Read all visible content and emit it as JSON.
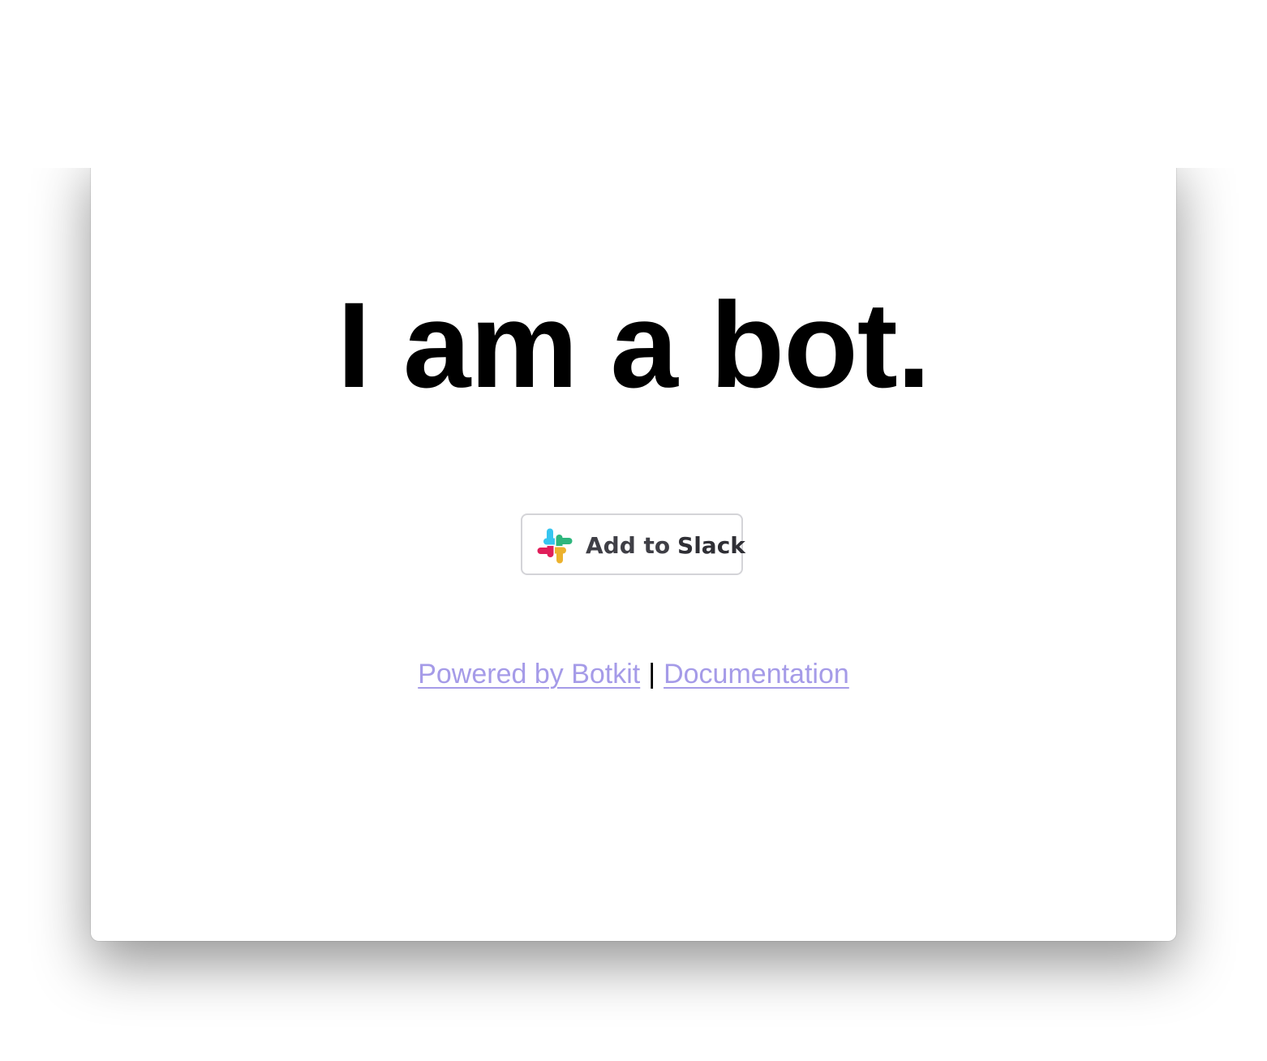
{
  "page": {
    "title": "I am a bot.",
    "add_to_slack": {
      "prefix": "Add to",
      "brand": "Slack",
      "icon": "slack-logo-icon"
    },
    "links": {
      "powered_by": "Powered by Botkit",
      "separator": "|",
      "documentation": "Documentation"
    }
  },
  "colors": {
    "background": "#ffffff",
    "headline": "#000000",
    "link": "#a59be8",
    "button_border": "#d4d4d8",
    "slack_blue": "#36c5f0",
    "slack_green": "#2eb67d",
    "slack_red": "#e01e5a",
    "slack_yellow": "#ecb22e"
  }
}
